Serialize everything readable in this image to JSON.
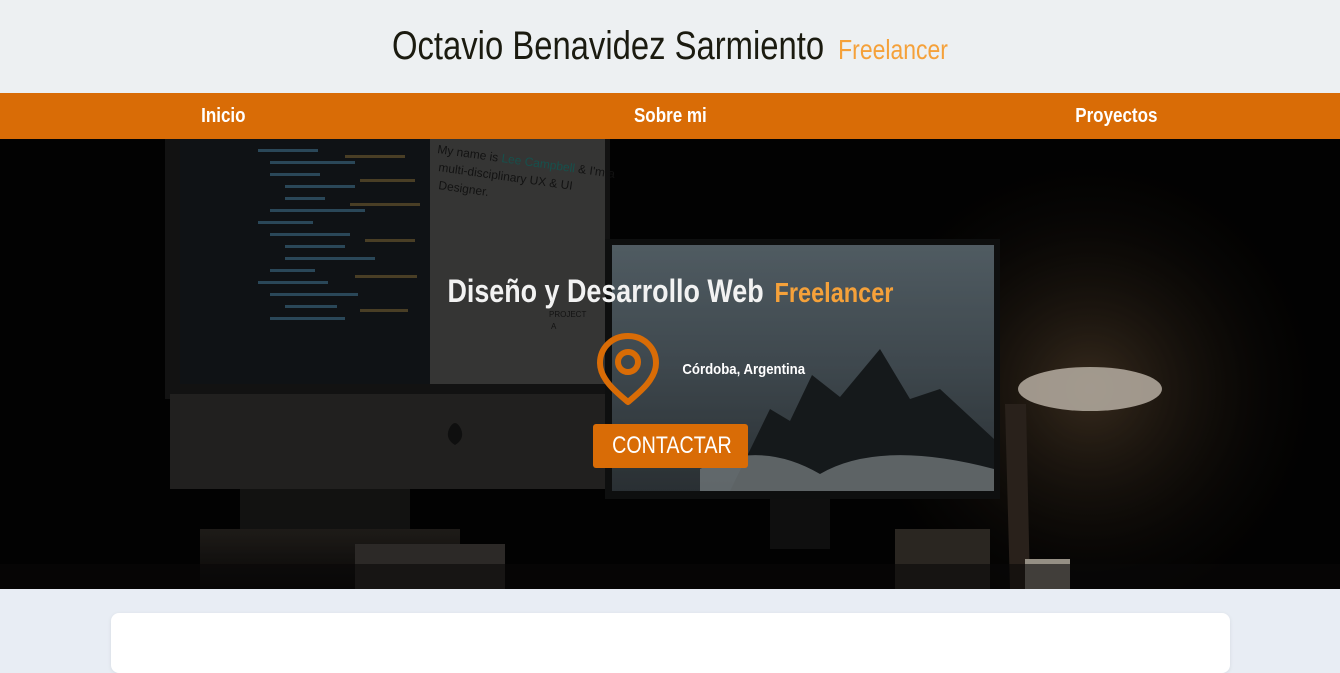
{
  "header": {
    "name": "Octavio Benavidez Sarmiento",
    "tag": "Freelancer"
  },
  "nav": {
    "items": [
      {
        "label": "Inicio"
      },
      {
        "label": "Sobre mi"
      },
      {
        "label": "Proyectos"
      }
    ]
  },
  "hero": {
    "title": "Diseño y Desarrollo Web",
    "title_accent": "Freelancer",
    "location": "Córdoba, Argentina",
    "cta_label": "CONTACTAR",
    "photo_text": {
      "line1_pre": "My name is",
      "line1_name": "Lee Campbell",
      "line1_post": "& I'm a",
      "line2": "multi-disciplinary UX & UI",
      "line3": "Designer.",
      "project": "PROJECT",
      "project_letter": "A"
    }
  },
  "colors": {
    "accent": "#d96c06",
    "accent_light": "#f5a13a",
    "header_bg": "#edf0f2",
    "page_bg": "#e8edf4"
  },
  "icons": {
    "location": "map-pin-icon"
  }
}
